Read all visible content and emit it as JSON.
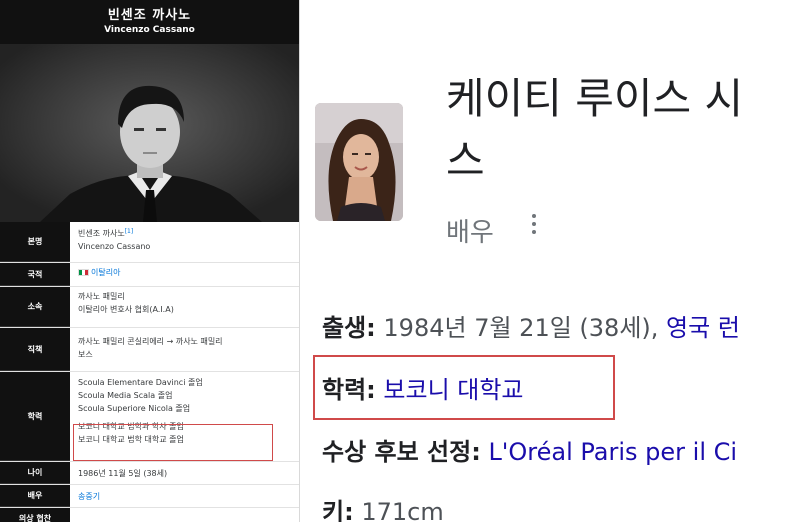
{
  "infobox": {
    "name_kr": "빈센조 까사노",
    "name_en": "Vincenzo Cassano",
    "rows": [
      {
        "label": "본명",
        "lines": [
          "빈센조 까사노",
          "Vincenzo Cassano"
        ],
        "sup": "[1]"
      },
      {
        "label": "국적",
        "lines": [
          "이탈리아"
        ],
        "flag": "italy-flag-icon"
      },
      {
        "label": "소속",
        "lines": [
          "까사노 패밀리",
          "이탈리아 변호사 협회(A.I.A)"
        ]
      },
      {
        "label": "직책",
        "lines": [
          "까사노 패밀리 콘실리에리 → 까사노 패밀리",
          "보스"
        ]
      },
      {
        "label": "학력",
        "lines": [
          "Scoula Elementare Davinci 졸업",
          "Scoula Media Scala 졸업",
          "Scoula Superiore Nicola 졸업",
          "보코니 대학교 법학과 학사 졸업",
          "보코니 대학교 법학 대학교 졸업"
        ]
      },
      {
        "label": "나이",
        "lines": [
          "1986년 11월 5일 (38세)"
        ]
      },
      {
        "label": "배우",
        "lines": [
          "송중기"
        ]
      },
      {
        "label": "의상 협찬",
        "lines": [
          ""
        ]
      }
    ]
  },
  "panel": {
    "title": "케이티 루이스 시\n스",
    "subtitle": "배우",
    "facts": {
      "birth_label": "출생:",
      "birth_value": "1984년 7월 21일 (38세),",
      "birth_place": "영국 런",
      "education_label": "학력:",
      "education_value": "보코니 대학교",
      "award_label": "수상 후보 선정:",
      "award_value": "L'Oréal Paris per il Ci",
      "height_label": "키:",
      "height_value": "171cm"
    }
  },
  "colors": {
    "highlight_box": "#d04a4a",
    "link_blue": "#1a0dab",
    "infobox_header": "#111111"
  }
}
